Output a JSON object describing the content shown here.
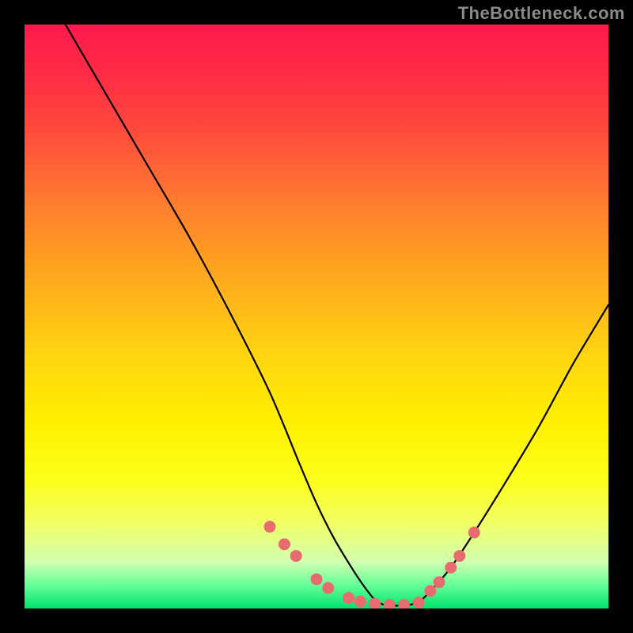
{
  "attribution": "TheBottleneck.com",
  "chart_data": {
    "type": "line",
    "title": "",
    "xlabel": "",
    "ylabel": "",
    "xlim": [
      0,
      100
    ],
    "ylim": [
      0,
      100
    ],
    "grid": false,
    "series": [
      {
        "name": "curve",
        "x": [
          7,
          14,
          21,
          28,
          35,
          42,
          47,
          50,
          53,
          56,
          58,
          60,
          62,
          64,
          66,
          68,
          70,
          73,
          77,
          82,
          88,
          94,
          100
        ],
        "values": [
          100,
          88,
          76,
          64,
          51,
          37,
          25,
          18,
          12,
          7,
          4,
          1.5,
          0.5,
          0.5,
          0.6,
          1.5,
          3.5,
          7,
          13,
          21,
          31,
          42,
          52
        ]
      }
    ],
    "markers": {
      "name": "dots",
      "color": "#e86b6f",
      "x": [
        42.0,
        44.5,
        46.5,
        50.0,
        52.0,
        55.5,
        57.5,
        60.0,
        62.5,
        65.0,
        67.5,
        69.5,
        71.0,
        73.0,
        74.5,
        77.0
      ],
      "values": [
        14.0,
        11.0,
        9.0,
        5.0,
        3.5,
        1.8,
        1.2,
        0.8,
        0.6,
        0.6,
        1.0,
        3.0,
        4.5,
        7.0,
        9.0,
        13.0
      ]
    },
    "gradient_stops": [
      {
        "offset": 0,
        "color": "#ff1a4d"
      },
      {
        "offset": 30,
        "color": "#ff7a2f"
      },
      {
        "offset": 68,
        "color": "#fff000"
      },
      {
        "offset": 96,
        "color": "#66ff99"
      },
      {
        "offset": 100,
        "color": "#00e26b"
      }
    ]
  }
}
